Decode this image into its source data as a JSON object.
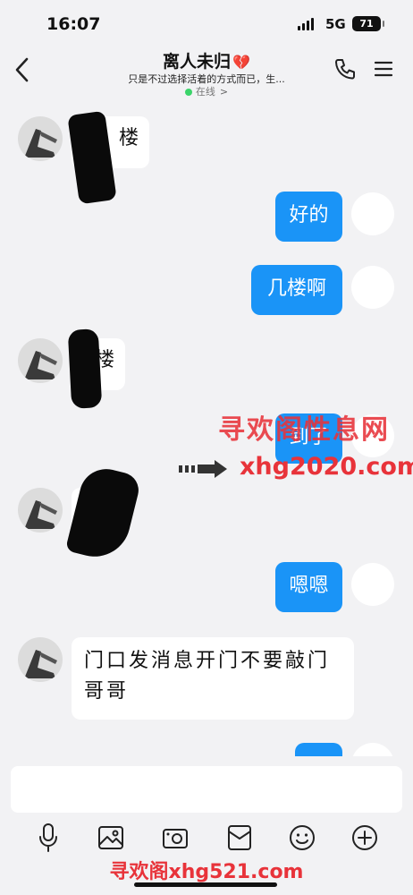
{
  "status_bar": {
    "time": "16:07",
    "network": "5G",
    "battery": "71"
  },
  "header": {
    "title": "离人未归",
    "title_emoji": "💔",
    "signature": "只是不过选择活着的方式而已，生...",
    "online_status": "在线",
    "online_chevron": ">"
  },
  "messages": [
    {
      "side": "in",
      "text": "楼"
    },
    {
      "side": "out",
      "text": "好的"
    },
    {
      "side": "out",
      "text": "几楼啊"
    },
    {
      "side": "in",
      "text": "楼"
    },
    {
      "side": "out",
      "text": "到了"
    },
    {
      "side": "in",
      "text": ""
    },
    {
      "side": "out",
      "text": "嗯嗯"
    },
    {
      "side": "in",
      "text": "门口发消息开门不要敲门哥哥"
    }
  ],
  "watermark": {
    "site_name": "寻欢阁性息网",
    "site_domain": "xhg2020.com",
    "bottom_text": "寻欢阁xhg521.com"
  },
  "toolbar": {
    "icons": [
      "microphone-icon",
      "image-icon",
      "camera-icon",
      "red-packet-icon",
      "emoji-icon",
      "plus-icon"
    ]
  },
  "colors": {
    "accent_blue": "#1a94f7",
    "background": "#f2f2f4",
    "watermark_red": "#e8333a",
    "online_green": "#3bd46a",
    "heart_red": "#e02b3c"
  }
}
